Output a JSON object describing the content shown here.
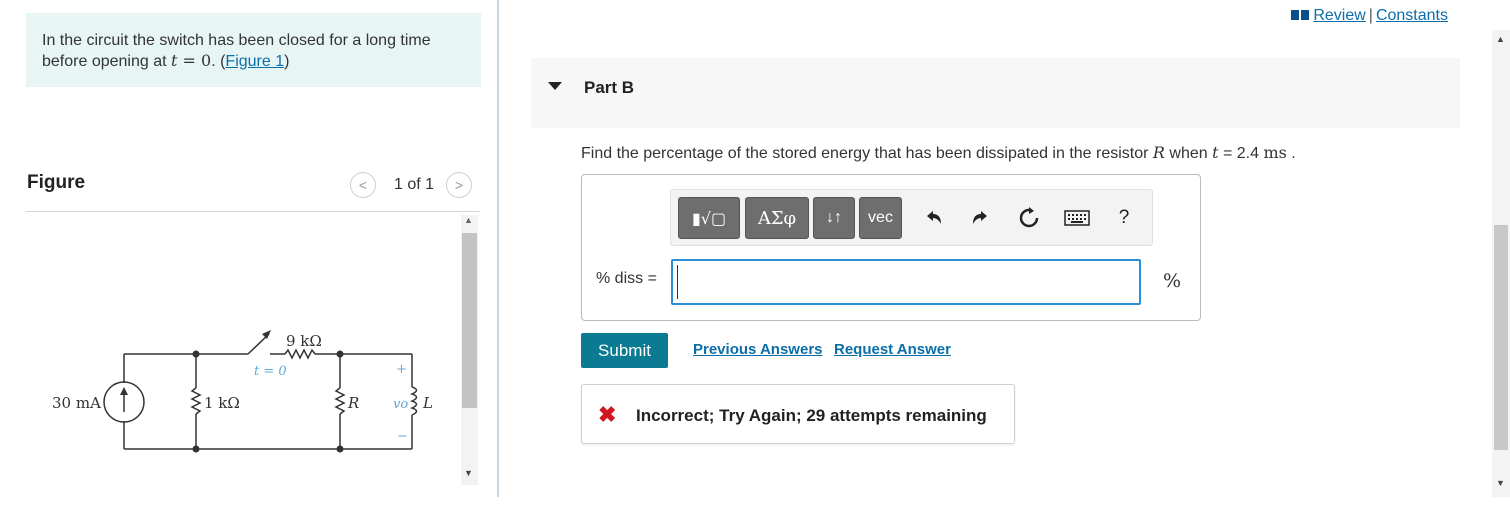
{
  "intro": {
    "text_before": "In the circuit the switch has been closed for a long time before opening at ",
    "t_var": "t",
    "eq": " = 0",
    "period": ". (",
    "figure_link": "Figure 1",
    "close": ")"
  },
  "figure": {
    "title": "Figure",
    "counter": "1 of 1",
    "prev": "<",
    "next": ">",
    "circuit": {
      "source_label": "30 mA",
      "r1_label": "1 kΩ",
      "r2_label": "9 kΩ",
      "switch_label": "t = 0",
      "r_label": "R",
      "v_label": "vo",
      "l_label": "L",
      "plus": "+",
      "minus": "−"
    }
  },
  "topnav": {
    "review": "Review",
    "sep": "|",
    "constants": "Constants"
  },
  "part": {
    "title": "Part B",
    "question_before": "Find the percentage of the stored energy that has been dissipated in the resistor ",
    "R_var": "R",
    "question_mid": " when ",
    "t_var": "t",
    "question_eq": " = 2.4 ",
    "unit": "ms",
    "question_end": " ."
  },
  "toolbar": {
    "templates_label": "▮√▢",
    "greek_label": "ΑΣφ",
    "arrows_label": "↓↑",
    "vec_label": "vec",
    "help_label": "?"
  },
  "answer": {
    "label": "% diss =",
    "value": "",
    "unit": "%"
  },
  "actions": {
    "submit": "Submit",
    "previous_answers": "Previous Answers",
    "request_answer": "Request Answer"
  },
  "feedback": {
    "icon": "✖",
    "text": "Incorrect; Try Again; 29 attempts remaining"
  }
}
